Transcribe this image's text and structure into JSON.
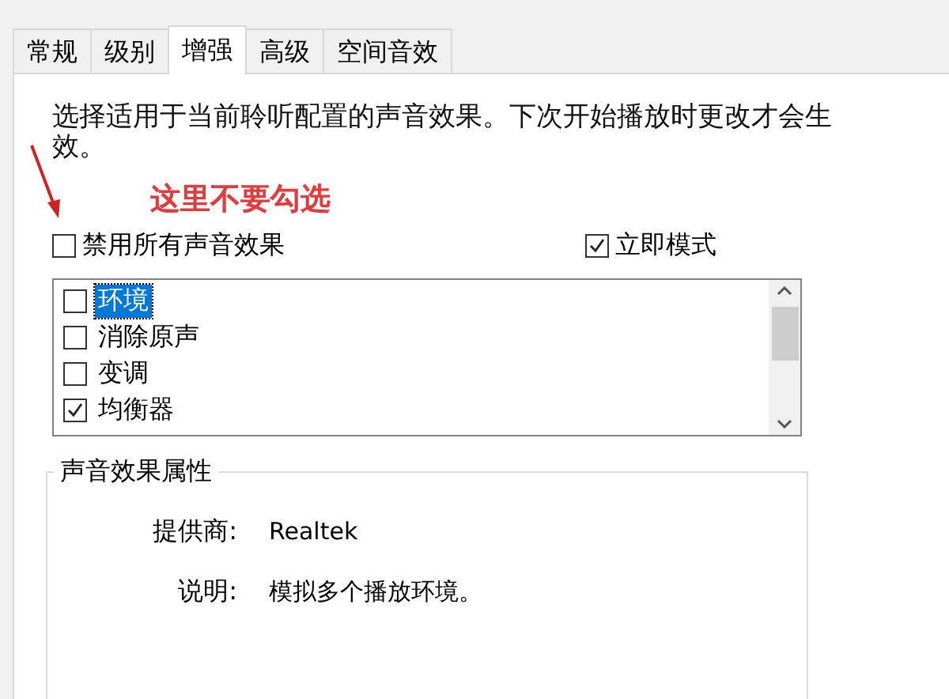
{
  "tabs": [
    {
      "label": "常规",
      "selected": false
    },
    {
      "label": "级别",
      "selected": false
    },
    {
      "label": "增强",
      "selected": true
    },
    {
      "label": "高级",
      "selected": false
    },
    {
      "label": "空间音效",
      "selected": false
    }
  ],
  "description": "选择适用于当前聆听配置的声音效果。下次开始播放时更改才会生效。",
  "annotation": "这里不要勾选",
  "options": [
    {
      "label": "禁用所有声音效果",
      "checked": false
    },
    {
      "label": "立即模式",
      "checked": true
    }
  ],
  "effects": [
    {
      "label": "环境",
      "checked": false,
      "selected": true
    },
    {
      "label": "消除原声",
      "checked": false,
      "selected": false
    },
    {
      "label": "变调",
      "checked": false,
      "selected": false
    },
    {
      "label": "均衡器",
      "checked": true,
      "selected": false
    }
  ],
  "properties": {
    "title": "声音效果属性",
    "rows": [
      {
        "label": "提供商:",
        "value": "Realtek"
      },
      {
        "label": "说明:",
        "value": "模拟多个播放环境。"
      }
    ]
  }
}
